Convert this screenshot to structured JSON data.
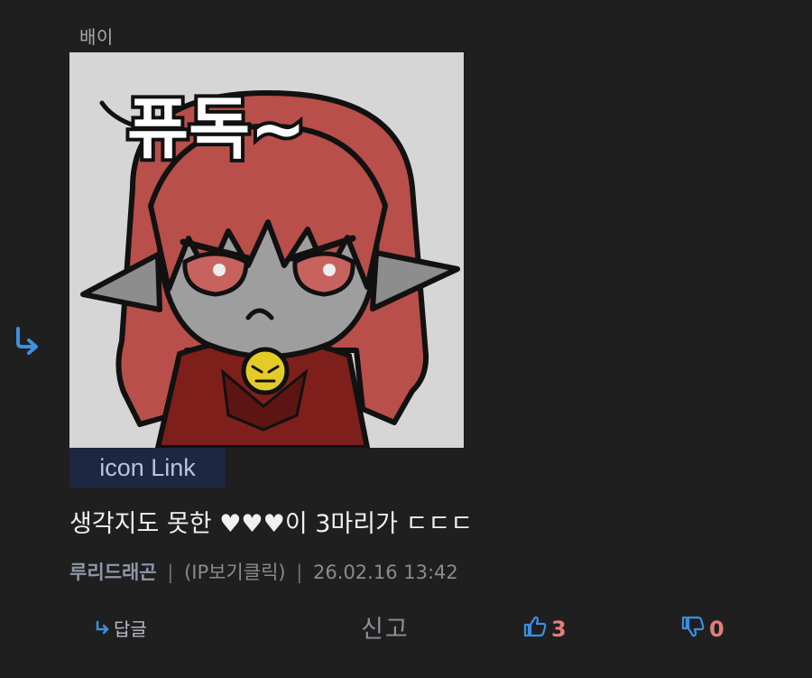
{
  "header": {
    "label": "배이"
  },
  "sticker": {
    "caption": "퓨독~",
    "link_label": "icon Link"
  },
  "comment": {
    "text": "생각지도 못한 ♥♥♥이 3마리가 ㄷㄷㄷ",
    "author": "루리드래곤",
    "separator": "|",
    "ip_label": "(IP보기클릭)",
    "timestamp": "26.02.16 13:42"
  },
  "actions": {
    "reply_label": "답글",
    "report_label": "신고",
    "like_count": "3",
    "dislike_count": "0"
  },
  "colors": {
    "background": "#1f1f20",
    "icon_link_bg": "#1d2741",
    "accent_blue": "#3c8fe0",
    "count_red": "#e17e7a"
  },
  "icons": {
    "reply_indent": "reply-arrow-icon",
    "reply": "reply-arrow-icon",
    "like": "thumbs-up-icon",
    "dislike": "thumbs-down-icon"
  }
}
